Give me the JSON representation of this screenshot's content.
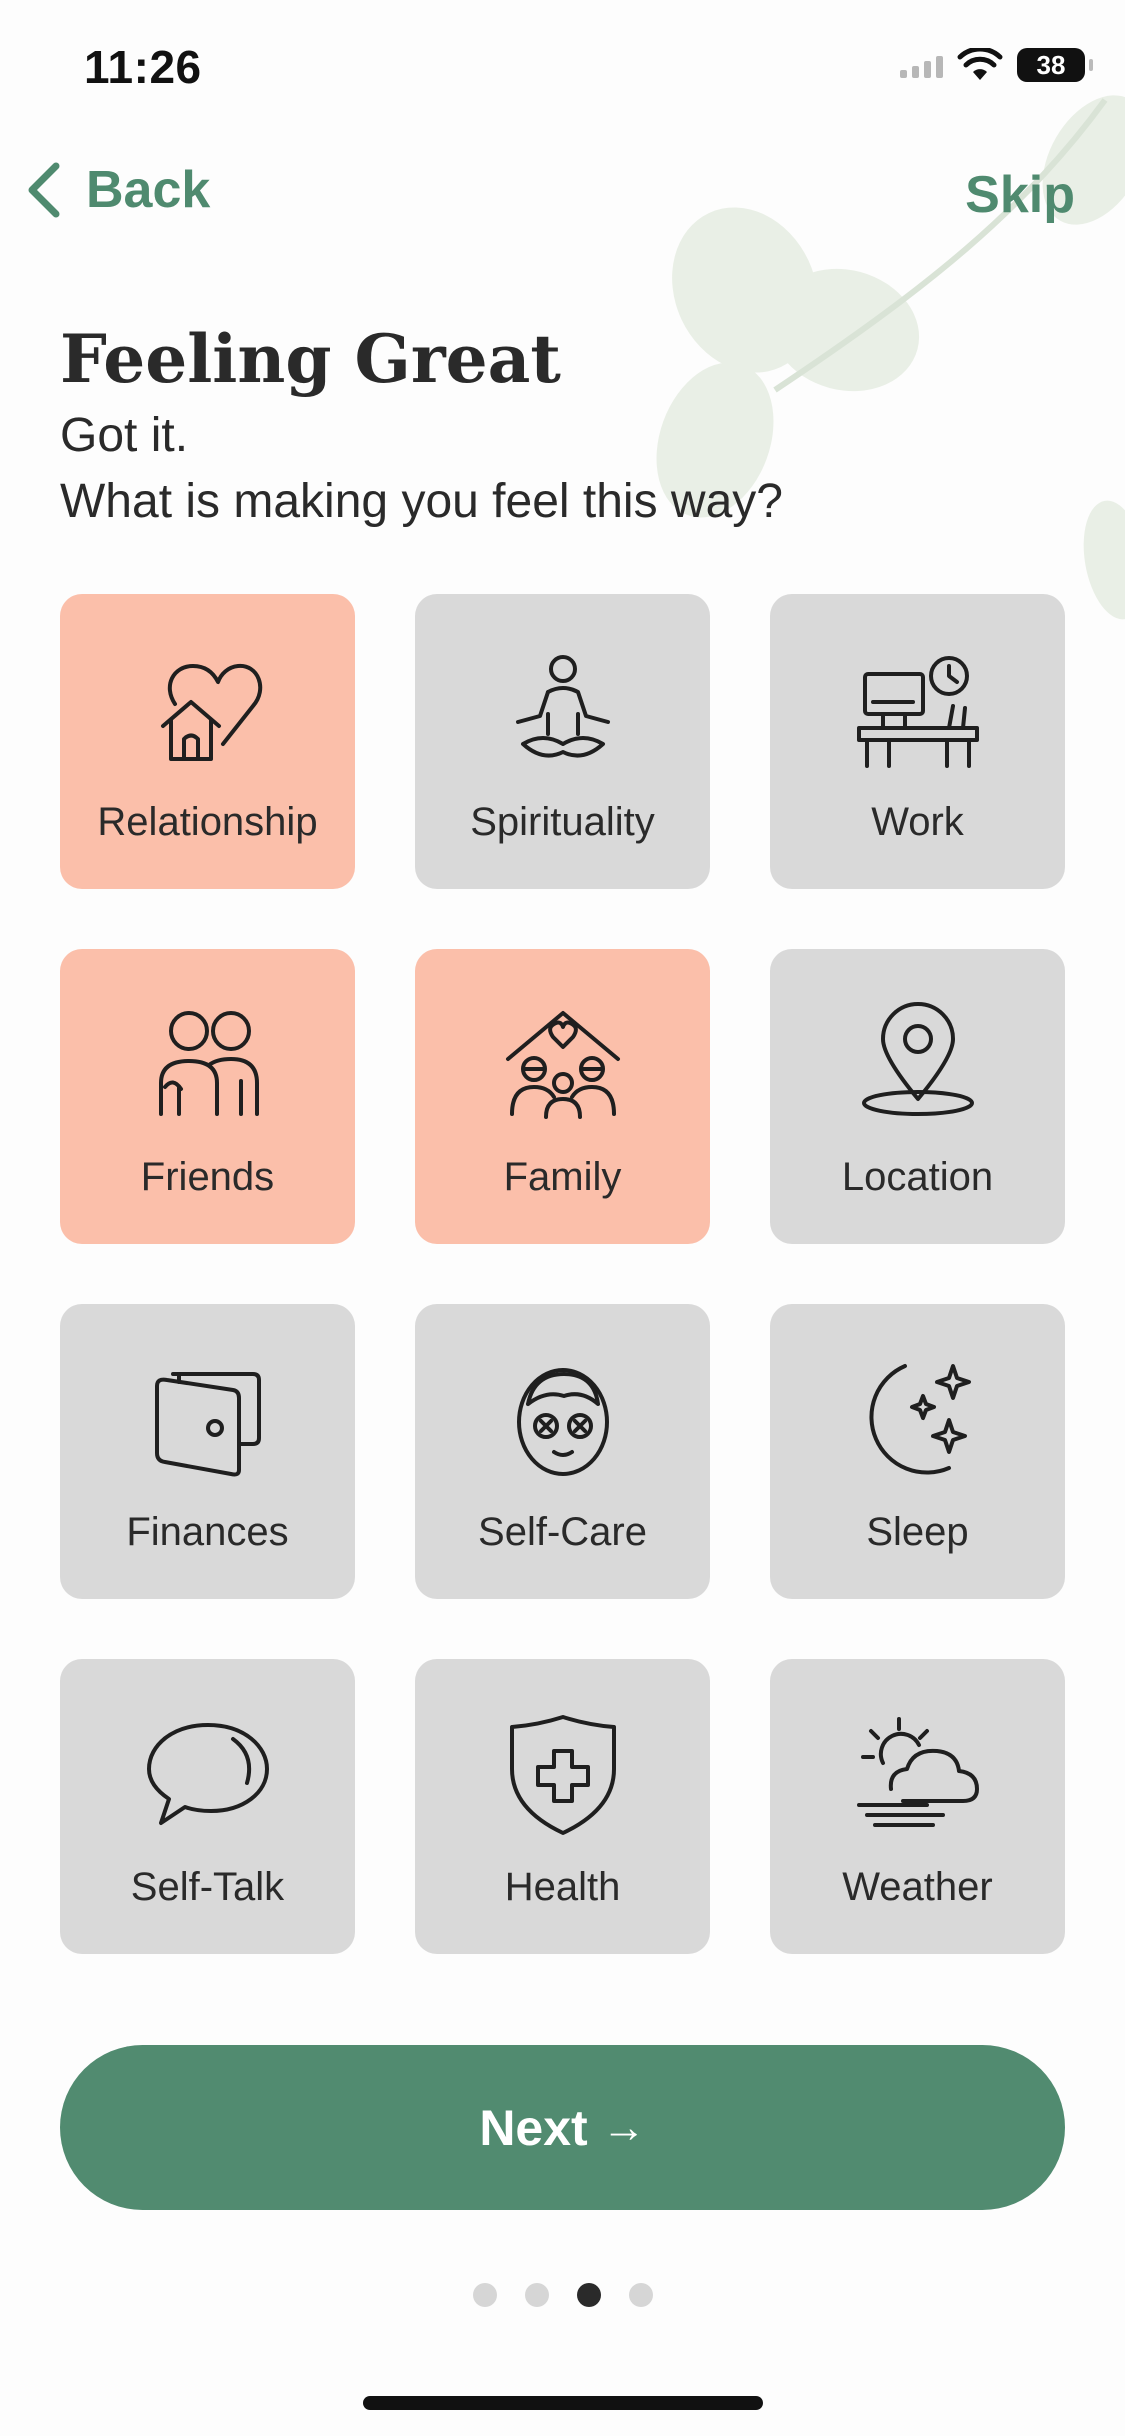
{
  "status": {
    "time": "11:26",
    "battery": "38"
  },
  "nav": {
    "back_label": "Back",
    "skip_label": "Skip"
  },
  "heading": {
    "title": "Feeling Great",
    "line1": "Got it.",
    "line2": "What is making you feel this way?"
  },
  "tiles": [
    {
      "label": "Relationship",
      "icon": "heart-house-icon",
      "selected": true
    },
    {
      "label": "Spirituality",
      "icon": "meditation-icon",
      "selected": false
    },
    {
      "label": "Work",
      "icon": "desk-icon",
      "selected": false
    },
    {
      "label": "Friends",
      "icon": "friends-icon",
      "selected": true
    },
    {
      "label": "Family",
      "icon": "family-icon",
      "selected": true
    },
    {
      "label": "Location",
      "icon": "location-pin-icon",
      "selected": false
    },
    {
      "label": "Finances",
      "icon": "wallet-icon",
      "selected": false
    },
    {
      "label": "Self-Care",
      "icon": "face-mask-icon",
      "selected": false
    },
    {
      "label": "Sleep",
      "icon": "moon-stars-icon",
      "selected": false
    },
    {
      "label": "Self-Talk",
      "icon": "speech-bubble-icon",
      "selected": false
    },
    {
      "label": "Health",
      "icon": "shield-cross-icon",
      "selected": false
    },
    {
      "label": "Weather",
      "icon": "sun-cloud-icon",
      "selected": false
    }
  ],
  "next": {
    "label": "Next",
    "arrow": "→"
  },
  "pagination": {
    "total": 4,
    "active_index": 2
  },
  "colors": {
    "accent": "#518b70",
    "selected_tile": "#fbbfaa",
    "tile": "#d9d9d9"
  }
}
